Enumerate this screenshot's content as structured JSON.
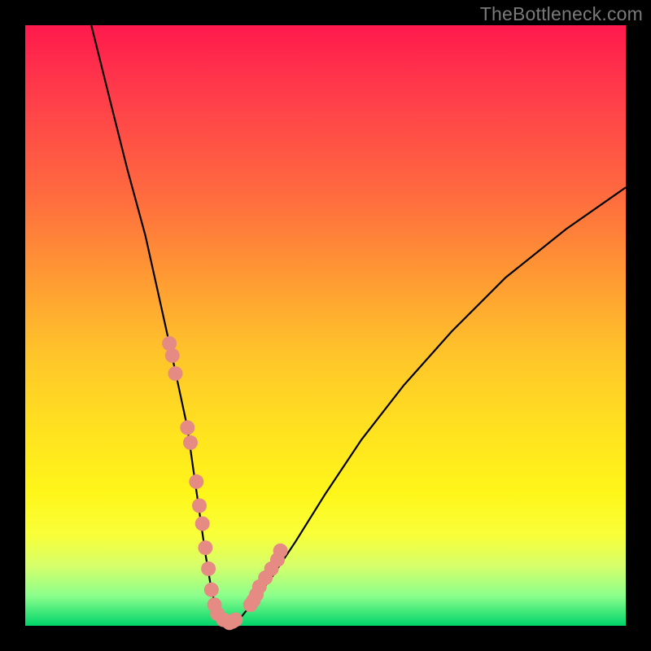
{
  "watermark": "TheBottleneck.com",
  "chart_data": {
    "type": "line",
    "title": "",
    "xlabel": "",
    "ylabel": "",
    "xlim": [
      0,
      100
    ],
    "ylim": [
      0,
      100
    ],
    "curve": {
      "x": [
        11,
        14,
        17,
        20,
        22,
        24,
        25.5,
        27,
        28,
        29,
        30,
        31,
        32,
        34,
        36,
        38,
        41,
        45,
        50,
        56,
        63,
        71,
        80,
        90,
        100
      ],
      "y": [
        100,
        88,
        76,
        65,
        56,
        47,
        40,
        33,
        26,
        19,
        12,
        6,
        2,
        0.5,
        1.5,
        4,
        8,
        14,
        22,
        31,
        40,
        49,
        58,
        66,
        73
      ]
    },
    "markers": {
      "x": [
        24.0,
        24.5,
        25.0,
        27.0,
        27.5,
        28.5,
        29.0,
        29.5,
        30.0,
        30.5,
        31.0,
        31.5,
        32.0,
        33.0,
        34.0,
        34.5,
        35.0,
        37.5,
        38.0,
        38.5,
        39.0,
        40.0,
        41.0,
        42.0,
        42.5
      ],
      "y": [
        47,
        45,
        42,
        33,
        30.5,
        24,
        20,
        17,
        13,
        9.5,
        6,
        3.5,
        2,
        1,
        0.5,
        0.7,
        1.0,
        3.5,
        4.2,
        5.2,
        6.5,
        8,
        9.5,
        11,
        12.5
      ]
    },
    "marker_color": "#e58b84",
    "curve_color": "#000000"
  }
}
